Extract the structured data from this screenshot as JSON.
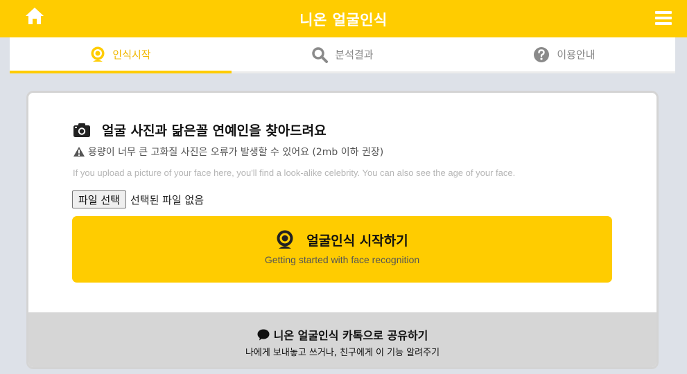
{
  "header": {
    "title": "니온 얼굴인식",
    "icons": {
      "home": "home-icon",
      "menu": "hamburger-menu-icon"
    },
    "color": "#ffcc00"
  },
  "tabs": [
    {
      "label": "인식시작",
      "icon": "webcam-icon",
      "active": true
    },
    {
      "label": "분석결과",
      "icon": "search-icon",
      "active": false
    },
    {
      "label": "이용안내",
      "icon": "question-circle-icon",
      "active": false
    }
  ],
  "upload": {
    "heading": "얼굴 사진과 닮은꼴 연예인을 찾아드려요",
    "heading_icon": "camera-icon",
    "warning": "용량이 너무 큰 고화질 사진은 오류가 발생할 수 있어요 (2mb 이하 권장)",
    "warning_icon": "warning-triangle-icon",
    "description": "If you upload a picture of your face here, you'll find a look-alike celebrity. You can also see the age of your face.",
    "file_button": "파일 선택",
    "file_status": "선택된 파일 없음"
  },
  "start_button": {
    "label": "얼굴인식 시작하기",
    "sublabel": "Getting started with face recognition",
    "icon": "webcam-icon"
  },
  "share": {
    "label": "니온 얼굴인식 카톡으로 공유하기",
    "sublabel": "나에게 보내놓고 쓰거나, 친구에게 이 기능 알려주기",
    "icon": "chat-bubble-icon"
  }
}
